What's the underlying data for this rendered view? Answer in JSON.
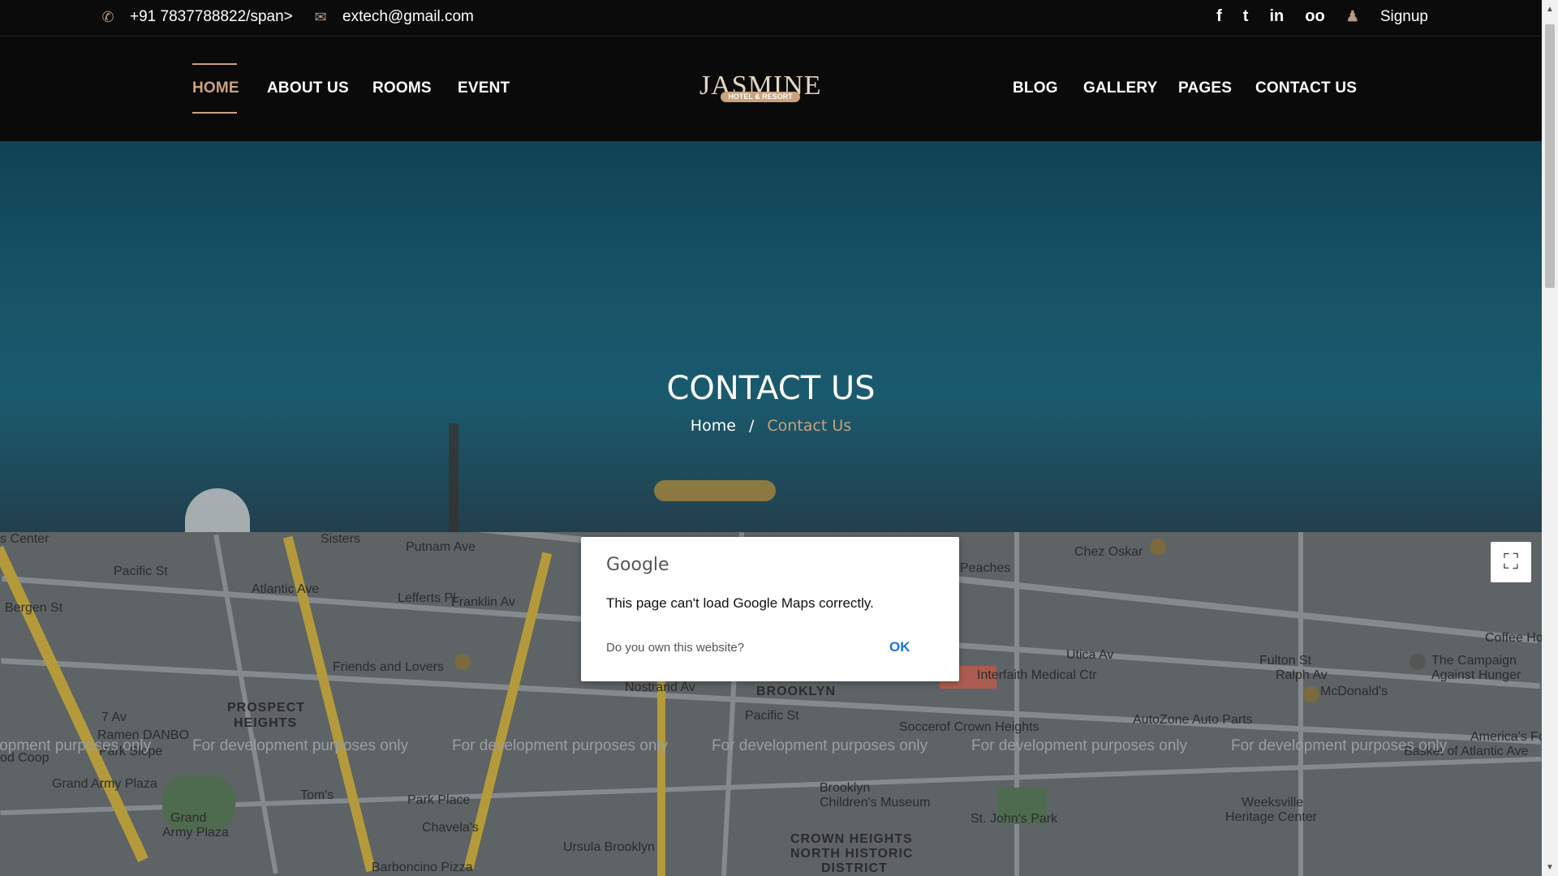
{
  "topbar": {
    "phone": "+91 7837788822/span>",
    "email": "extech@gmail.com",
    "social": [
      "f",
      "t",
      "in",
      "oo"
    ],
    "signup": "Signup"
  },
  "nav": {
    "left": [
      "HOME",
      "ABOUT US",
      "ROOMS",
      "EVENT"
    ],
    "right": [
      "BLOG",
      "GALLERY",
      "PAGES",
      "CONTACT US"
    ],
    "active": "HOME"
  },
  "logo": {
    "word": "JASMINE",
    "sub": "HOTEL & RESORT"
  },
  "hero": {
    "title": "CONTACT US",
    "crumb_home": "Home",
    "crumb_sep": "/",
    "crumb_current": "Contact Us"
  },
  "map": {
    "watermark": "For development purposes only",
    "labels": [
      "s Center",
      "Pacific St",
      "Bergen St",
      "Atlantic Ave",
      "Sisters",
      "Putnam Ave",
      "Lefferts Pl",
      "Franklin Av",
      "Friends and Lovers",
      "PROSPECT",
      "HEIGHTS",
      "7 Av",
      "Ramen DANBO",
      "Park Slope",
      "Grand Army Plaza",
      "Tom's",
      "Park Place",
      "Chavela's",
      "Ursula Brooklyn",
      "Barboncino Pizza",
      "BROOKLYN",
      "Nostrand Av",
      "Pacific St",
      "Brooklyn",
      "Children's Museum",
      "Soccerof Crown Heights",
      "Interfaith Medical Ctr",
      "Utica Av",
      "AutoZone Auto Parts",
      "St. John's Park",
      "CROWN HEIGHTS",
      "NORTH HISTORIC",
      "DISTRICT",
      "Weeksville",
      "Heritage Center",
      "Chez Oskar",
      "Peaches",
      "Fulton St",
      "Ralph Av",
      "McDonald's",
      "The Campaign",
      "Against Hunger",
      "Coffee Ho",
      "America's Food",
      "Basket of Atlantic Ave",
      "Grand",
      "Army Plaza",
      "od Coop"
    ]
  },
  "dialog": {
    "brand": "Google",
    "message": "This page can't load Google Maps correctly.",
    "question": "Do you own this website?",
    "ok": "OK"
  },
  "fullscreen_icon": "fullscreen-icon"
}
